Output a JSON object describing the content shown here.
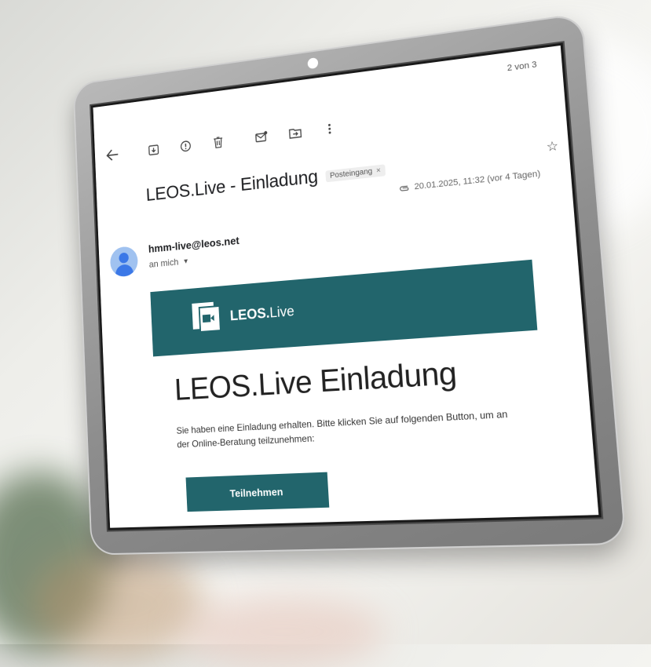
{
  "toolbar": {
    "back": "back-arrow-icon",
    "archive": "archive-icon",
    "report_spam": "report-spam-icon",
    "delete": "trash-icon",
    "mark_unread": "mark-unread-icon",
    "move_to": "move-to-icon",
    "more": "more-vert-icon"
  },
  "pager": "2 von 3",
  "email": {
    "subject": "LEOS.Live - Einladung",
    "label": "Posteingang",
    "label_remove": "×",
    "date": "20.01.2025, 11:32 (vor 4 Tagen)",
    "sender": "hmm-live@leos.net",
    "recipient": "an mich"
  },
  "content": {
    "brand_bold": "LEOS.",
    "brand_light": "Live",
    "heading": "LEOS.Live Einladung",
    "body": "Sie haben eine Einladung erhalten. Bitte klicken Sie auf folgenden Button, um an der Online-Beratung teilzunehmen:",
    "button_label": "Teilnehmen"
  },
  "colors": {
    "accent": "#22656c",
    "avatar": "#3b78e7",
    "tablet_frame": "#8e8e8e"
  }
}
